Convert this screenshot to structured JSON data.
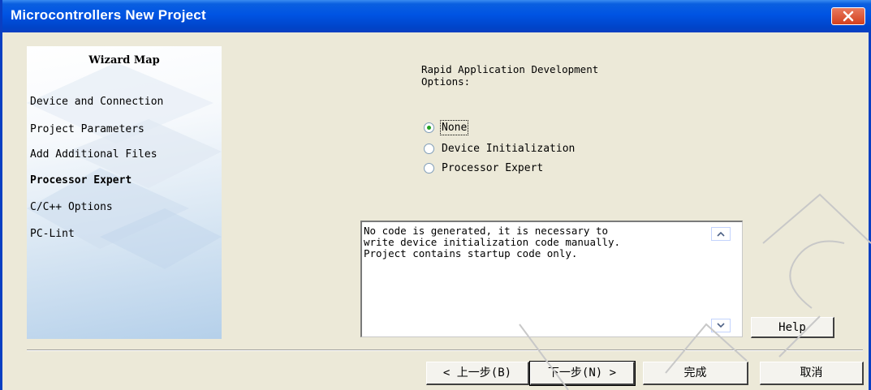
{
  "window": {
    "title": "Microcontrollers New Project"
  },
  "wizard_map": {
    "title": "Wizard Map",
    "steps": [
      {
        "label": "Device and Connection",
        "active": false
      },
      {
        "label": "Project Parameters",
        "active": false
      },
      {
        "label": "Add Additional Files",
        "active": false
      },
      {
        "label": "Processor Expert",
        "active": true
      },
      {
        "label": "C/C++ Options",
        "active": false
      },
      {
        "label": "PC-Lint",
        "active": false
      }
    ]
  },
  "rad": {
    "label": "Rapid Application Development\nOptions:",
    "options": [
      {
        "label": "None",
        "selected": true
      },
      {
        "label": "Device Initialization",
        "selected": false
      },
      {
        "label": "Processor Expert",
        "selected": false
      }
    ]
  },
  "description": {
    "text": "No code is generated, it is necessary to\nwrite device initialization code manually.\nProject contains startup code only."
  },
  "buttons": {
    "help": "Help",
    "back": "< 上一步(B)",
    "next": "下一步(N) >",
    "finish": "完成",
    "cancel": "取消"
  },
  "colors": {
    "title_bar": "#0054e3",
    "close_button": "#d4401d",
    "dialog_bg": "#ece9d8",
    "radio_dot": "#21a121"
  }
}
